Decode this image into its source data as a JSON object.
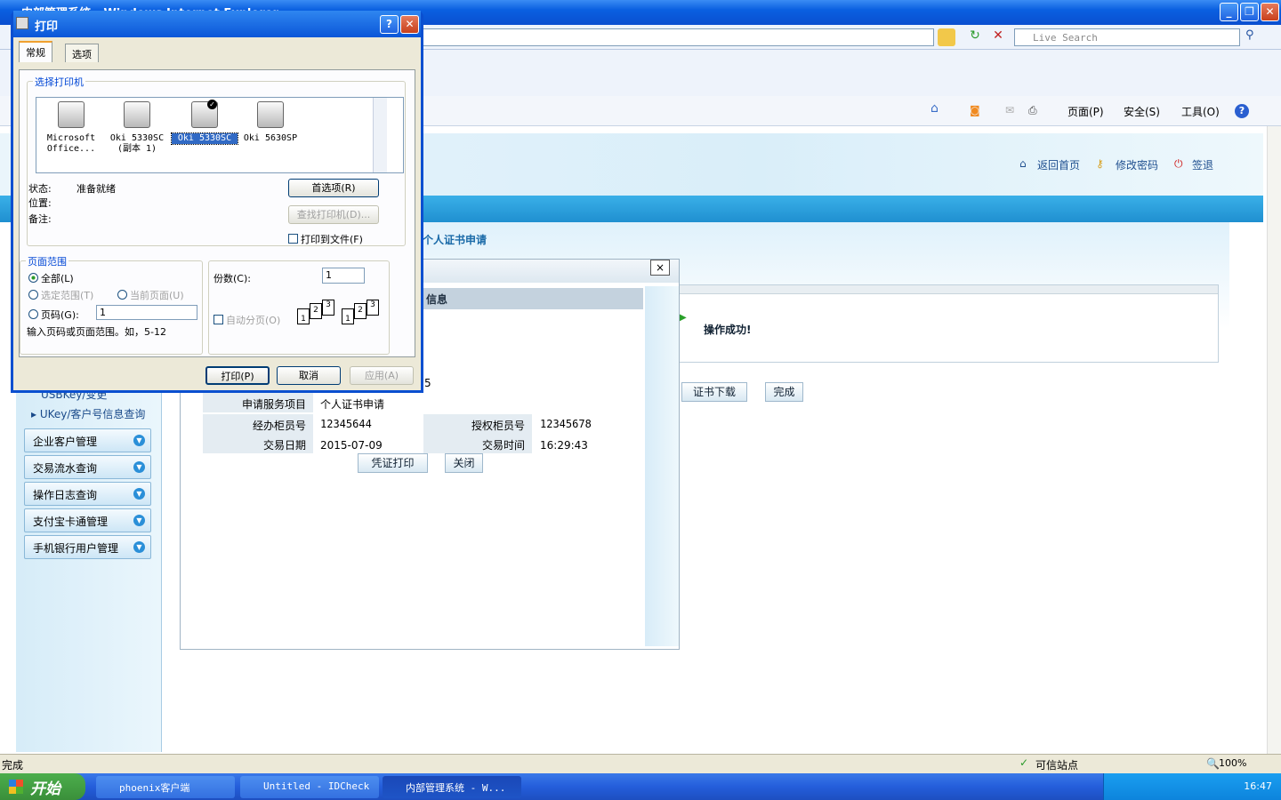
{
  "ie": {
    "title": "内部管理系统 - Windows Internet Explorer",
    "live_search_placeholder": "Live Search",
    "cmd": {
      "page": "页面(P)",
      "safety": "安全(S)",
      "tools": "工具(O)"
    }
  },
  "site": {
    "links": {
      "home": "返回首页",
      "change_password": "修改密码",
      "logout": "签退"
    },
    "breadcrumb": "个人证书申请",
    "sidebar": {
      "partial_item": "USBKey/变更",
      "ukey_query": "UKey/客户号信息查询",
      "menus": [
        "企业客户管理",
        "交易流水查询",
        "操作日志查询",
        "支付宝卡通管理",
        "手机银行用户管理"
      ]
    },
    "result": {
      "message": "操作成功!",
      "cert_download": "证书下载",
      "finish": "完成"
    }
  },
  "popup": {
    "close_glyph": "×",
    "info_header": "信息",
    "partial_value": "5",
    "rows": {
      "service_label": "申请服务项目",
      "service_value": "个人证书申请",
      "operator_label": "经办柜员号",
      "operator_value": "12345644",
      "auth_label": "授权柜员号",
      "auth_value": "12345678",
      "date_label": "交易日期",
      "date_value": "2015-07-09",
      "time_label": "交易时间",
      "time_value": "16:29:43"
    },
    "print_voucher": "凭证打印",
    "close": "关闭"
  },
  "dialog": {
    "title": "打印",
    "tabs": [
      "常规",
      "选项"
    ],
    "select_printer": "选择打印机",
    "printers": [
      {
        "line1": "Microsoft",
        "line2": "Office..."
      },
      {
        "line1": "Oki 5330SC",
        "line2": "(副本 1)"
      },
      {
        "line1": "Oki 5330SC",
        "line2": ""
      },
      {
        "line1": "Oki 5630SP",
        "line2": ""
      }
    ],
    "status_label": "状态:",
    "status_value": "准备就绪",
    "location_label": "位置:",
    "comment_label": "备注:",
    "preferences": "首选项(R)",
    "find_printer": "查找打印机(D)...",
    "print_to_file": "打印到文件(F)",
    "page_range": "页面范围",
    "all": "全部(L)",
    "selection": "选定范围(T)",
    "current_page": "当前页面(U)",
    "pages": "页码(G):",
    "pages_value": "1",
    "hint": "输入页码或页面范围。如，5-12",
    "copies": "份数(C):",
    "copies_value": "1",
    "collate": "自动分页(O)",
    "print": "打印(P)",
    "cancel": "取消",
    "apply": "应用(A)"
  },
  "statusbar": {
    "left": "完成",
    "trusted": "可信站点",
    "zoom": "100%"
  },
  "taskbar": {
    "start": "开始",
    "tasks": [
      "phoenix客户端",
      "Untitled - IDCheck",
      "内部管理系统 - W..."
    ],
    "clock": "16:47"
  }
}
